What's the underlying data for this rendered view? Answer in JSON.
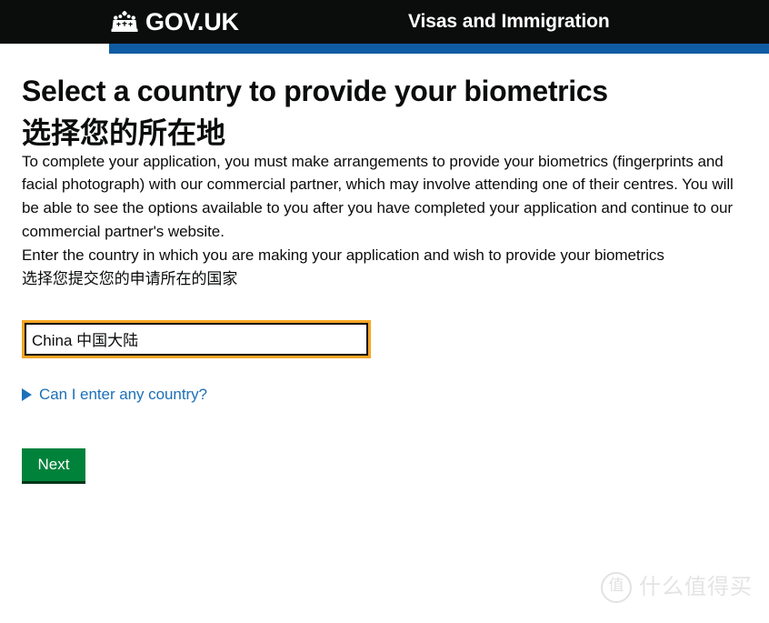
{
  "header": {
    "brand_label": "GOV.UK",
    "crown_icon": "crown-icon",
    "service_name": "Visas and Immigration",
    "background_color": "#0b0c0c",
    "accent_bar_color": "#105ca4"
  },
  "page": {
    "title_en": "Select a country to provide your biometrics",
    "title_cn": "选择您的所在地",
    "intro_paragraph": "To complete your application, you must make arrangements to provide your biometrics (fingerprints and facial photograph) with our commercial partner, which may involve attending one of their centres. You will be able to see the options available to you after you have completed your application and continue to our commercial partner's website.",
    "prompt_en": "Enter the country in which you are making your application and wish to provide your biometrics",
    "prompt_cn": "选择您提交您的申请所在的国家"
  },
  "country_field": {
    "name": "country-input",
    "value": "China 中国大陆",
    "placeholder": "",
    "focus_ring_color": "#f5a623",
    "border_color": "#0b0c0c"
  },
  "details": {
    "arrow_icon": "triangle-right-icon",
    "label": "Can I enter any country?",
    "link_color": "#1d70b8",
    "expanded": false
  },
  "actions": {
    "next_label": "Next",
    "next_color": "#00823b"
  },
  "watermark": {
    "badge_char": "值",
    "text": "什么值得买",
    "color": "#e4e4e4"
  }
}
